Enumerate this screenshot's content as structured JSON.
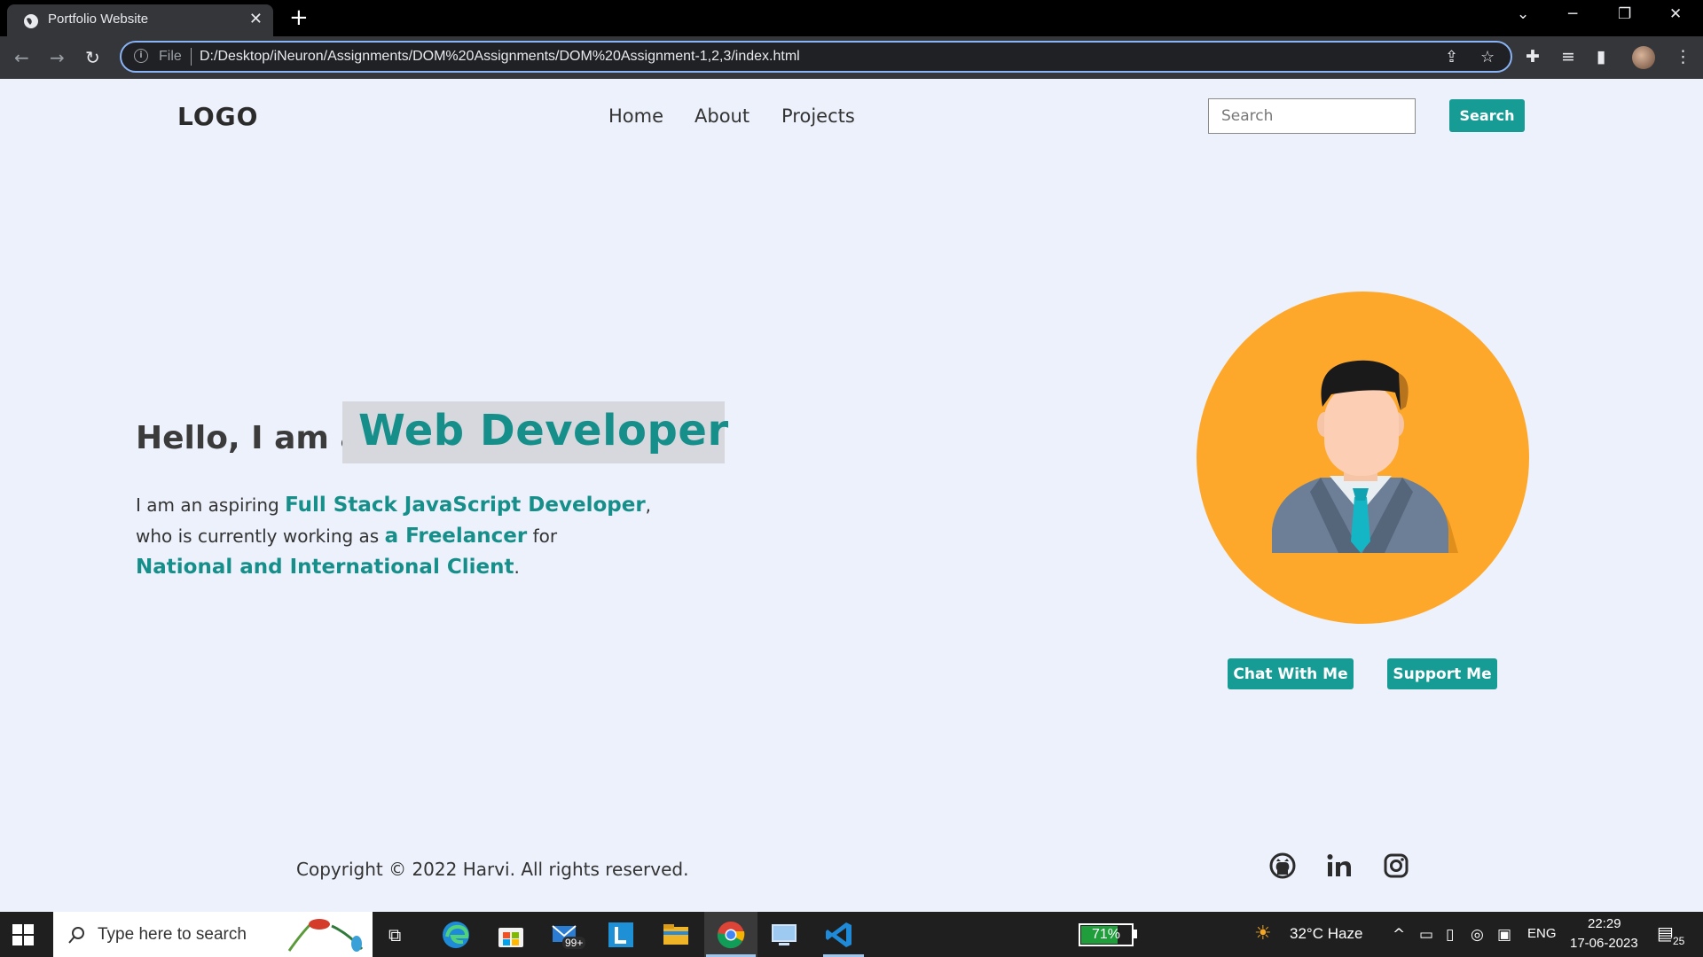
{
  "browser": {
    "tab_title": "Portfolio Website",
    "new_tab_label": "+",
    "url_scheme": "File",
    "url": "D:/Desktop/iNeuron/Assignments/DOM%20Assignments/DOM%20Assignment-1,2,3/index.html"
  },
  "header": {
    "logo": "LOGO",
    "nav": [
      "Home",
      "About",
      "Projects"
    ],
    "search_placeholder": "Search",
    "search_button": "Search"
  },
  "hero": {
    "greeting": "Hello, I am a",
    "role": "Web Developer",
    "line1_pre": "I am an aspiring ",
    "line1_hl": "Full Stack JavaScript Developer",
    "line1_post": ",",
    "line2_pre": "who is currently working as ",
    "line2_hl": "a Freelancer",
    "line2_post": " for",
    "line3_hl": "National and International Client",
    "line3_post": ".",
    "chat_button": "Chat With Me",
    "support_button": "Support Me"
  },
  "footer": {
    "copyright": "Copyright © 2022 Harvi. All rights reserved.",
    "social_icons": [
      "github-icon",
      "linkedin-icon",
      "instagram-icon"
    ]
  },
  "taskbar": {
    "search_placeholder": "Type here to search",
    "mail_badge": "99+",
    "battery": "71%",
    "weather": "32°C  Haze",
    "language": "ENG",
    "time": "22:29",
    "date": "17-06-2023",
    "notifications": "25"
  },
  "colors": {
    "accent": "#179c95",
    "page_bg": "#edf1fb",
    "avatar_bg": "#fea82b"
  }
}
